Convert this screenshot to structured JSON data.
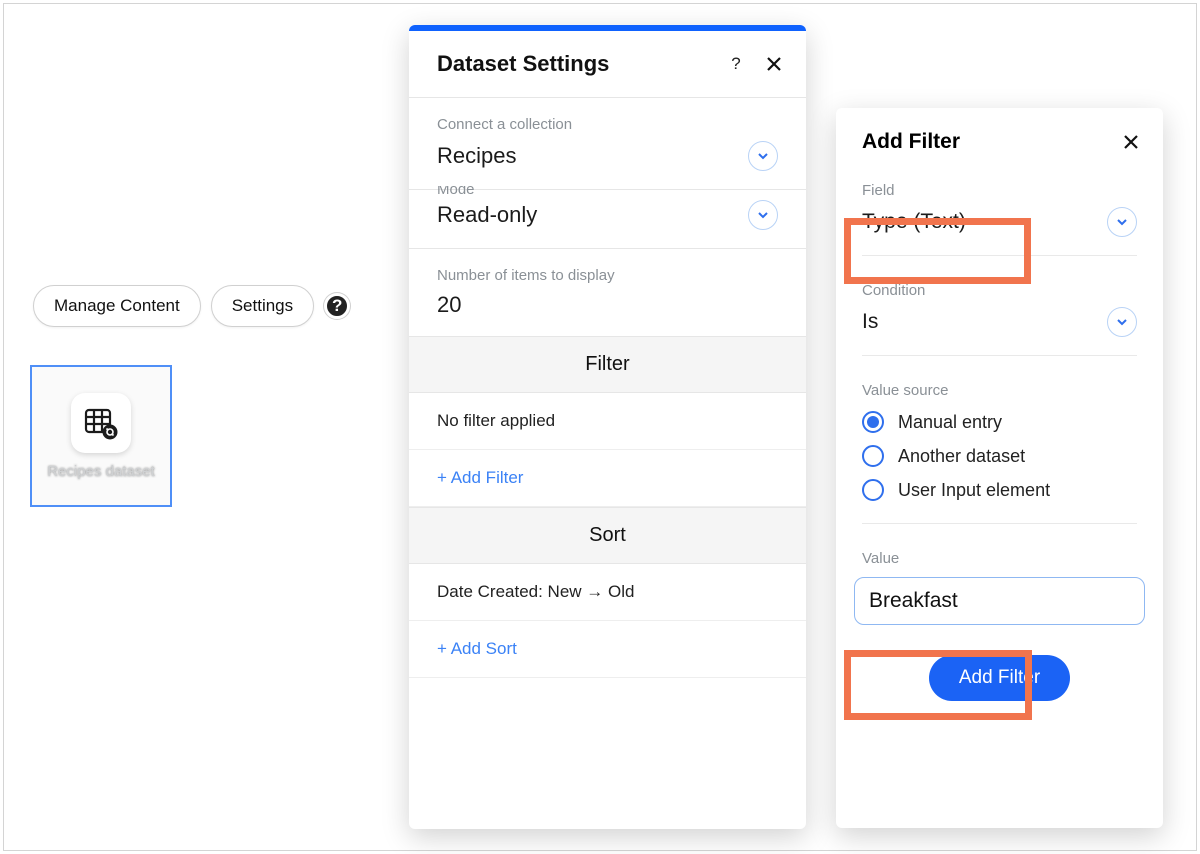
{
  "pills": {
    "manage": "Manage Content",
    "settings": "Settings"
  },
  "tile": {
    "label": "Recipes dataset"
  },
  "settings_panel": {
    "title": "Dataset Settings",
    "collection_label": "Connect a collection",
    "collection_value": "Recipes",
    "mode_label_clipped": "Mode",
    "mode_value": "Read-only",
    "items_label": "Number of items to display",
    "items_value": "20",
    "filter_head": "Filter",
    "filter_none": "No filter applied",
    "add_filter": "+ Add Filter",
    "sort_head": "Sort",
    "sort_value": "Date Created: New → Old",
    "add_sort": "+ Add Sort"
  },
  "filter_panel": {
    "title": "Add Filter",
    "field_label": "Field",
    "field_value": "Type (Text)",
    "condition_label": "Condition",
    "condition_value": "Is",
    "source_label": "Value source",
    "sources": [
      "Manual entry",
      "Another dataset",
      "User Input element"
    ],
    "source_selected": 0,
    "value_label": "Value",
    "value_input": "Breakfast",
    "submit": "Add Filter"
  }
}
